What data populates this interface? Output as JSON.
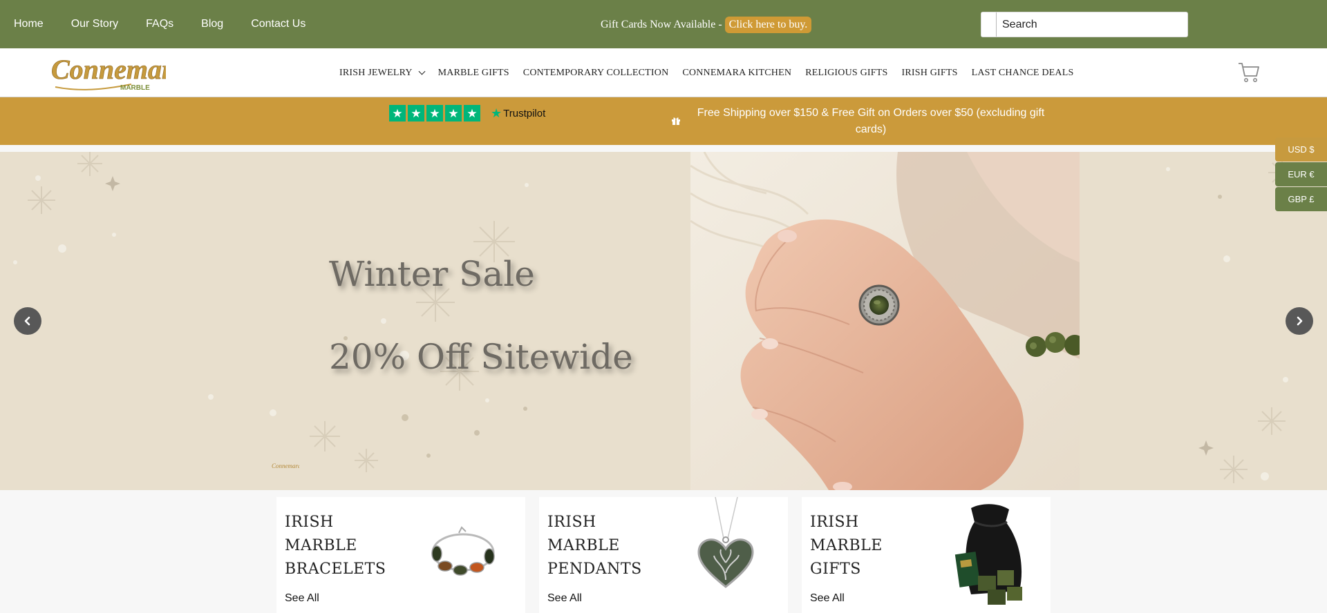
{
  "topbar": {
    "links": [
      "Home",
      "Our Story",
      "FAQs",
      "Blog",
      "Contact Us"
    ],
    "promo_text": "Gift Cards Now Available - ",
    "promo_button": "Click here to buy.",
    "search_placeholder": "Search"
  },
  "header": {
    "logo_text": "Connemara",
    "logo_sub": "MARBLE",
    "nav": [
      "IRISH JEWELRY",
      "MARBLE GIFTS",
      "CONTEMPORARY COLLECTION",
      "CONNEMARA KITCHEN",
      "RELIGIOUS GIFTS",
      "IRISH GIFTS",
      "LAST CHANCE DEALS"
    ],
    "cart_icon": "shopping-cart-icon"
  },
  "shipbar": {
    "trustpilot_label": "Trustpilot",
    "trustpilot_stars": 5,
    "shipping_text": "Free Shipping over $150 & Free Gift on Orders over $50 (excluding gift cards)"
  },
  "currency": {
    "options": [
      "USD $",
      "EUR €",
      "GBP £"
    ],
    "selected": "USD $"
  },
  "hero": {
    "title": "Winter Sale",
    "subtitle": "20% Off Sitewide",
    "mini_logo_text": "Connemara"
  },
  "categories": [
    {
      "title": "IRISH MARBLE BRACELETS",
      "link": "See All"
    },
    {
      "title": "IRISH MARBLE PENDANTS",
      "link": "See All"
    },
    {
      "title": "IRISH MARBLE GIFTS",
      "link": "See All"
    }
  ],
  "colors": {
    "topbar_green": "#6b8048",
    "gold": "#cb9a3b",
    "trustpilot_green": "#00b67a",
    "hero_bg": "#e8dfcd"
  }
}
